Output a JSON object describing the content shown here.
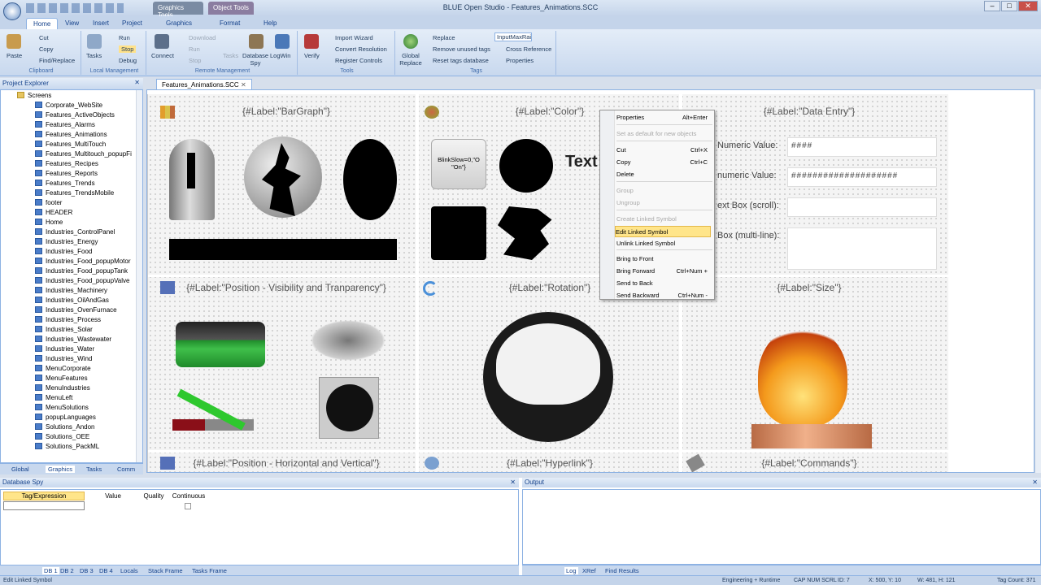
{
  "app": {
    "title": "BLUE Open Studio - Features_Animations.SCC",
    "contextual_tabs": [
      "Graphics Tools",
      "Object Tools"
    ],
    "ribbon_tabs": [
      "Home",
      "View",
      "Insert",
      "Project",
      "Graphics",
      "Format",
      "Help"
    ]
  },
  "ribbon": {
    "clipboard": {
      "paste": "Paste",
      "cut": "Cut",
      "copy": "Copy",
      "find_replace": "Find/Replace",
      "label": "Clipboard"
    },
    "local": {
      "tasks": "Tasks",
      "run": "Run",
      "stop": "Stop",
      "debug": "Debug",
      "label": "Local Management"
    },
    "remote": {
      "connect": "Connect",
      "download": "Download",
      "run": "Run",
      "stop": "Stop",
      "tasks": "Tasks",
      "db_spy": "Database Spy",
      "logwin": "LogWin",
      "label": "Remote Management"
    },
    "tools": {
      "verify": "Verify",
      "import_wizard": "Import Wizard",
      "convert_resolution": "Convert Resolution",
      "register_controls": "Register Controls",
      "label": "Tools"
    },
    "tags": {
      "global_replace": "Global Replace",
      "replace": "Replace",
      "remove_unused": "Remove unused tags",
      "reset_db": "Reset tags database",
      "tag_input": "InputMaxRai",
      "cross_ref": "Cross Reference",
      "properties": "Properties",
      "label": "Tags"
    }
  },
  "project_explorer": {
    "title": "Project Explorer",
    "root": "Screens",
    "items": [
      "Corporate_WebSite",
      "Features_ActiveObjects",
      "Features_Alarms",
      "Features_Animations",
      "Features_MultiTouch",
      "Features_Multitouch_popupFi",
      "Features_Recipes",
      "Features_Reports",
      "Features_Trends",
      "Features_TrendsMobile",
      "footer",
      "HEADER",
      "Home",
      "Industries_ControlPanel",
      "Industries_Energy",
      "Industries_Food",
      "Industries_Food_popupMotor",
      "Industries_Food_popupTank",
      "Industries_Food_popupValve",
      "Industries_Machinery",
      "Industries_OilAndGas",
      "Industries_OvenFurnace",
      "Industries_Process",
      "Industries_Solar",
      "Industries_Wastewater",
      "Industries_Water",
      "Industries_Wind",
      "MenuCorporate",
      "MenuFeatures",
      "MenuIndustries",
      "MenuLeft",
      "MenuSolutions",
      "popupLanguages",
      "Solutions_Andon",
      "Solutions_OEE",
      "Solutions_PackML"
    ],
    "tabs": [
      "Global",
      "Graphics",
      "Tasks",
      "Comm"
    ]
  },
  "document": {
    "tab": "Features_Animations.SCC",
    "cells": {
      "bargraph": "{#Label:\"BarGraph\"}",
      "color": "{#Label:\"Color\"}",
      "data_entry": "{#Label:\"Data Entry\"}",
      "visibility": "{#Label:\"Position - Visibility and Tranparency\"}",
      "rotation": "{#Label:\"Rotation\"}",
      "size": "{#Label:\"Size\"}",
      "horiz_vert": "{#Label:\"Position - Horizontal and Vertical\"}",
      "hyperlink": "{#Label:\"Hyperlink\"}",
      "commands": "{#Label:\"Commands\"}"
    },
    "blink_text": "BlinkSlow=0,\"O \"On\"}",
    "text_partial": "Text",
    "data_entry_rows": [
      {
        "label": "Numeric Value:",
        "value": "####"
      },
      {
        "label": "numeric Value:",
        "value": "####################"
      },
      {
        "label": "ext Box (scroll):",
        "value": ""
      },
      {
        "label": "Box (multi-line):",
        "value": ""
      }
    ]
  },
  "context_menu": {
    "items": [
      {
        "label": "Properties",
        "shortcut": "Alt+Enter",
        "disabled": false
      },
      {
        "label": "Set as default for new objects",
        "shortcut": "",
        "disabled": true
      },
      {
        "label": "Cut",
        "shortcut": "Ctrl+X",
        "disabled": false
      },
      {
        "label": "Copy",
        "shortcut": "Ctrl+C",
        "disabled": false
      },
      {
        "label": "Delete",
        "shortcut": "",
        "disabled": false
      },
      {
        "label": "Group",
        "shortcut": "",
        "disabled": true
      },
      {
        "label": "Ungroup",
        "shortcut": "",
        "disabled": true
      },
      {
        "label": "Create Linked Symbol",
        "shortcut": "",
        "disabled": true
      },
      {
        "label": "Edit Linked Symbol",
        "shortcut": "",
        "disabled": false,
        "highlighted": true
      },
      {
        "label": "Unlink Linked Symbol",
        "shortcut": "",
        "disabled": false
      },
      {
        "label": "Bring to Front",
        "shortcut": "",
        "disabled": false
      },
      {
        "label": "Bring Forward",
        "shortcut": "Ctrl+Num +",
        "disabled": false
      },
      {
        "label": "Send to Back",
        "shortcut": "",
        "disabled": false
      },
      {
        "label": "Send Backward",
        "shortcut": "Ctrl+Num -",
        "disabled": false
      }
    ]
  },
  "database_spy": {
    "title": "Database Spy",
    "columns": [
      "Tag/Expression",
      "Value",
      "Quality",
      "Continuous"
    ],
    "tabs": [
      "DB 1",
      "DB 2",
      "DB 3",
      "DB 4",
      "Locals",
      "Stack Frame",
      "Tasks Frame"
    ]
  },
  "output": {
    "title": "Output",
    "tabs": [
      "Log",
      "XRef",
      "Find Results"
    ]
  },
  "status": {
    "left": "Edit Linked Symbol",
    "mode": "Engineering + Runtime",
    "caps": "CAP NUM SCRL",
    "id": "ID: 7",
    "pos": "X: 500, Y: 10",
    "size": "W: 481, H: 121",
    "tag_count": "Tag Count: 371"
  },
  "colors": {
    "accent": "#1e395b",
    "ribbon": "#c8d8ee",
    "highlight": "#ffe58a"
  }
}
